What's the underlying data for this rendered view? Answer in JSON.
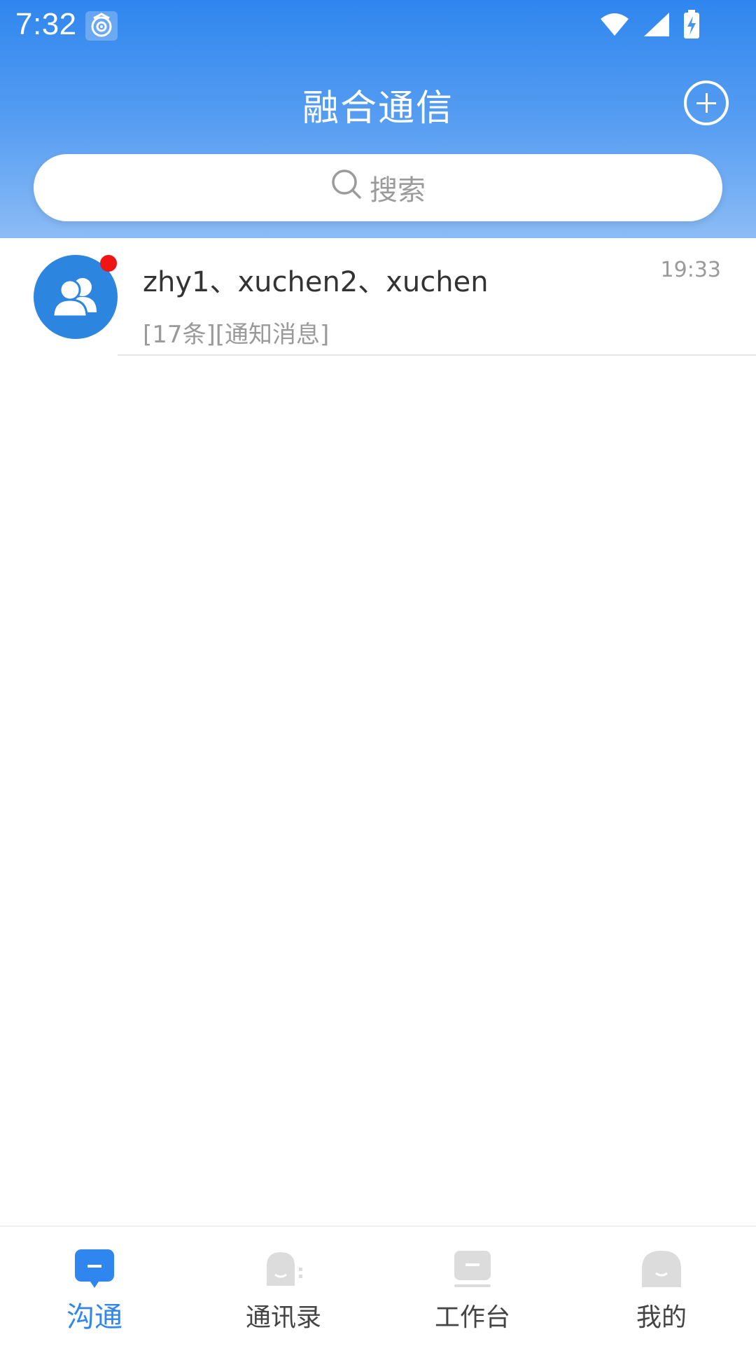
{
  "status_bar": {
    "time": "7:32"
  },
  "header": {
    "title": "融合通信"
  },
  "search": {
    "placeholder": "搜索"
  },
  "conversations": [
    {
      "name": "zhy1、xuchen2、xuchen",
      "preview": "[17条][通知消息]",
      "time": "19:33",
      "unread": true,
      "avatar_icon": "group-icon"
    }
  ],
  "bottom_nav": {
    "items": [
      {
        "label": "沟通",
        "icon": "chat-icon",
        "active": true
      },
      {
        "label": "通讯录",
        "icon": "contacts-icon",
        "active": false
      },
      {
        "label": "工作台",
        "icon": "workbench-icon",
        "active": false
      },
      {
        "label": "我的",
        "icon": "profile-icon",
        "active": false
      }
    ]
  },
  "colors": {
    "accent": "#2f86ee",
    "unread_dot": "#f01515",
    "avatar_bg": "#2c86e0"
  }
}
